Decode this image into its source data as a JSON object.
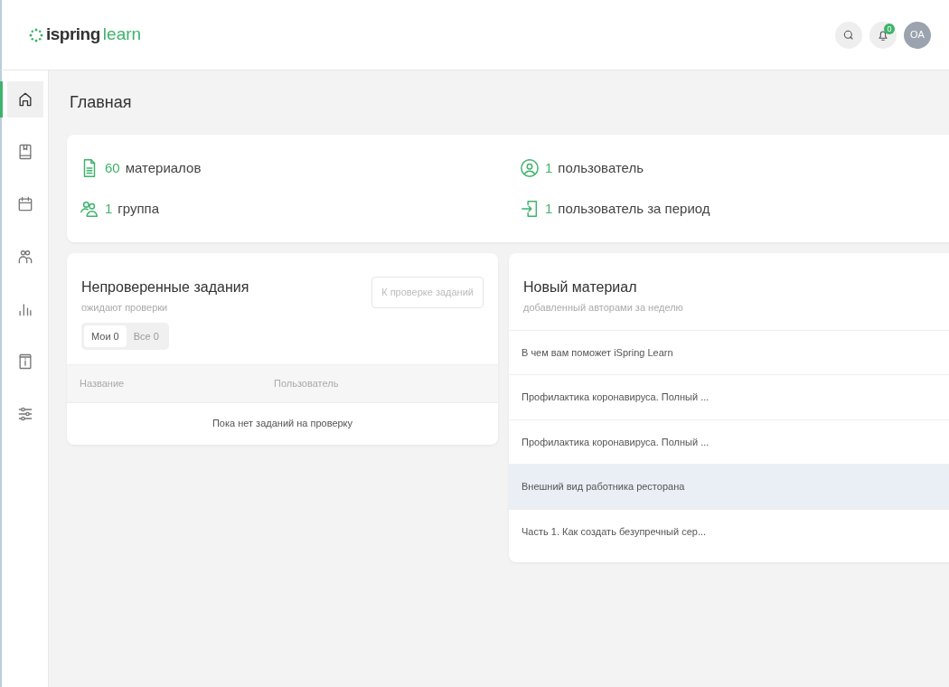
{
  "header": {
    "logo_prefix": "ispring",
    "logo_suffix": "learn",
    "notifications_count": "0",
    "avatar": "OA"
  },
  "sidebar": {
    "items": [
      {
        "kind": "home",
        "selected": true
      },
      {
        "kind": "book",
        "selected": false
      },
      {
        "kind": "calendar",
        "selected": false
      },
      {
        "kind": "users",
        "selected": false
      },
      {
        "kind": "chart",
        "selected": false
      },
      {
        "kind": "info",
        "selected": false
      },
      {
        "kind": "sliders",
        "selected": false
      }
    ]
  },
  "page_title": "Главная",
  "stats": [
    {
      "kind": "document",
      "number": "60",
      "label": "материалов"
    },
    {
      "kind": "user",
      "number": "1",
      "label": "пользователь"
    },
    {
      "kind": "group",
      "number": "1",
      "label": "группа"
    },
    {
      "kind": "login",
      "number": "1",
      "label": "пользователь за период"
    }
  ],
  "unchecked_tasks": {
    "title": "Непроверенные задания",
    "subtitle": "ожидают проверки",
    "button": "К проверке заданий",
    "tabs": [
      {
        "label": "Мои 0",
        "selected": true
      },
      {
        "label": "Все 0",
        "selected": false
      }
    ],
    "columns": [
      "Название",
      "Пользователь"
    ],
    "empty_text": "Пока нет заданий на проверку"
  },
  "new_material": {
    "title": "Новый материал",
    "subtitle": "добавленный авторами за неделю",
    "items": [
      {
        "title": "В чем вам поможет iSpring Learn",
        "selected": false
      },
      {
        "title": "Профилактика коронавируса. Полный ...",
        "selected": false
      },
      {
        "title": "Профилактика коронавируса. Полный ...",
        "selected": false
      },
      {
        "title": "Внешний вид работника ресторана",
        "selected": true
      },
      {
        "title": "Часть 1. Как создать безупречный сер...",
        "selected": false
      }
    ]
  }
}
